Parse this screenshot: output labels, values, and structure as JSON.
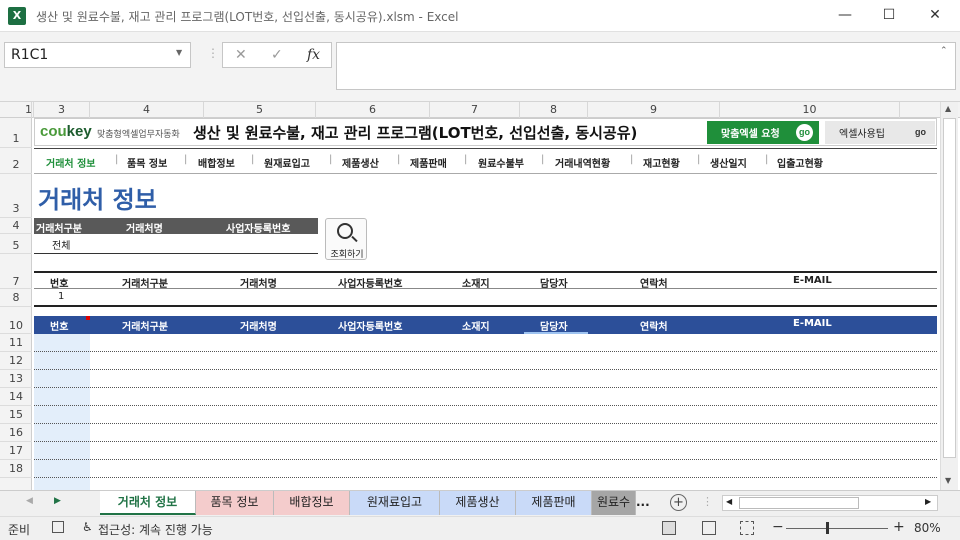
{
  "window": {
    "icon_letter": "X",
    "title": "생산 및 원료수불, 재고 관리 프로그램(LOT번호, 선입선출, 동시공유).xlsm  -  Excel",
    "minimize": "—",
    "maximize": "☐",
    "close": "✕"
  },
  "formula_bar": {
    "name_box": "R1C1",
    "cancel": "✕",
    "enter": "✓",
    "fx": "fx",
    "formula": ""
  },
  "columns": [
    "1",
    "3",
    "4",
    "5",
    "6",
    "7",
    "8",
    "9",
    "10"
  ],
  "rows": [
    "1",
    "2",
    "3",
    "4",
    "5",
    "7",
    "8",
    "10",
    "11",
    "12",
    "13",
    "14",
    "15",
    "16",
    "17",
    "18"
  ],
  "banner": {
    "logo_a": "cou",
    "logo_b": "key",
    "logo_tag": "맞춤형엑셀업무자동화",
    "title": "생산 및 원료수불, 재고 관리 프로그램(LOT번호, 선입선출, 동시공유)",
    "request_btn": "맞춤엑셀 요청",
    "tip_btn": "엑셀사용팁",
    "go": "go"
  },
  "nav": [
    "거래처 정보",
    "품목 정보",
    "배합정보",
    "원재료입고",
    "제품생산",
    "제품판매",
    "원료수불부",
    "거래내역현황",
    "재고현황",
    "생산일지",
    "입출고현황"
  ],
  "nav_sep": "|",
  "page_title": "거래처 정보",
  "search": {
    "headers": [
      "거래처구분",
      "거래처명",
      "사업자등록번호"
    ],
    "value": "전체",
    "button": "조회하기"
  },
  "table_headers": [
    "번호",
    "거래처구분",
    "거래처명",
    "사업자등록번호",
    "소재지",
    "담당자",
    "연락처",
    "E-MAIL"
  ],
  "table1_row": [
    "1"
  ],
  "sheet_tabs": [
    "거래처 정보",
    "품목 정보",
    "배합정보",
    "원재료입고",
    "제품생산",
    "제품판매",
    "원료수"
  ],
  "sheet_more": "...",
  "sheet_add": "+",
  "status": {
    "ready": "준비",
    "accessibility": "접근성: 계속 진행 가능",
    "zoom": "80%",
    "zoom_minus": "−",
    "zoom_plus": "+"
  },
  "colors": {
    "accent_green": "#1f8f3a",
    "title_blue": "#2f5ea8",
    "table_header_blue": "#2c4f99",
    "excel_green": "#1d6f42"
  }
}
